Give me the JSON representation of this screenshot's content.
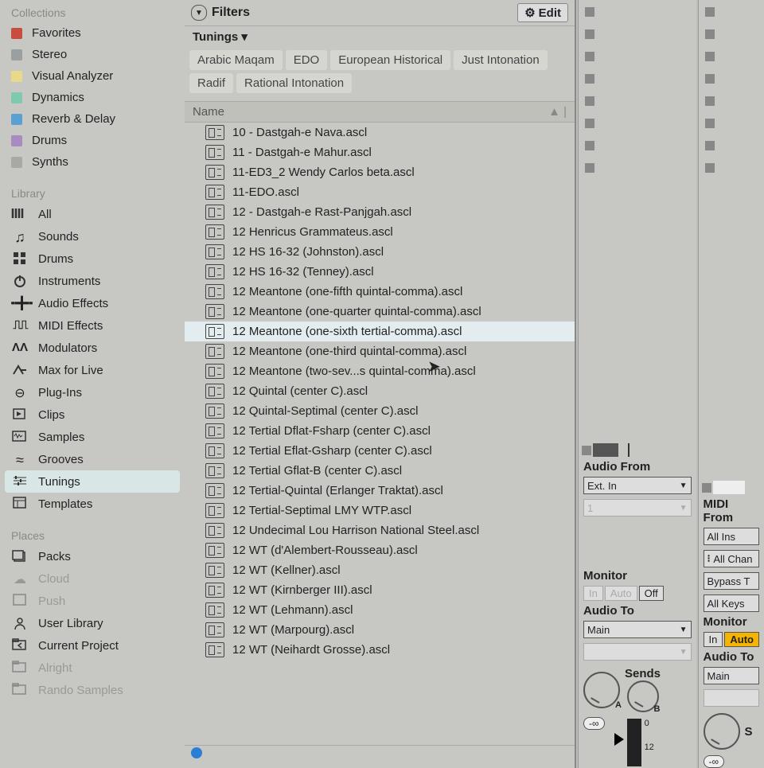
{
  "sidebar": {
    "collections_hd": "Collections",
    "collections": [
      {
        "label": "Favorites",
        "color": "#c84d3e"
      },
      {
        "label": "Stereo",
        "color": "#9aa0a0"
      },
      {
        "label": "Visual Analyzer",
        "color": "#e9d98b"
      },
      {
        "label": "Dynamics",
        "color": "#7fc9b0"
      },
      {
        "label": "Reverb & Delay",
        "color": "#5aa0d0"
      },
      {
        "label": "Drums",
        "color": "#a88bc0"
      },
      {
        "label": "Synths",
        "color": "#a8a8a4"
      }
    ],
    "library_hd": "Library",
    "library": [
      {
        "label": "All",
        "icon": "bars"
      },
      {
        "label": "Sounds",
        "icon": "note"
      },
      {
        "label": "Drums",
        "icon": "pads"
      },
      {
        "label": "Instruments",
        "icon": "power"
      },
      {
        "label": "Audio Effects",
        "icon": "wave"
      },
      {
        "label": "MIDI Effects",
        "icon": "midi"
      },
      {
        "label": "Modulators",
        "icon": "mod"
      },
      {
        "label": "Max for Live",
        "icon": "max"
      },
      {
        "label": "Plug-Ins",
        "icon": "plug"
      },
      {
        "label": "Clips",
        "icon": "clip"
      },
      {
        "label": "Samples",
        "icon": "samp"
      },
      {
        "label": "Grooves",
        "icon": "groove"
      },
      {
        "label": "Tunings",
        "icon": "tune",
        "selected": true
      },
      {
        "label": "Templates",
        "icon": "tmpl"
      }
    ],
    "places_hd": "Places",
    "places": [
      {
        "label": "Packs",
        "icon": "packs"
      },
      {
        "label": "Cloud",
        "icon": "cloud",
        "dim": true
      },
      {
        "label": "Push",
        "icon": "push",
        "dim": true
      },
      {
        "label": "User Library",
        "icon": "user"
      },
      {
        "label": "Current Project",
        "icon": "proj"
      },
      {
        "label": "Alright",
        "icon": "folder",
        "dim": true
      },
      {
        "label": "Rando Samples",
        "icon": "folder",
        "dim": true
      }
    ]
  },
  "browser": {
    "filters_label": "Filters",
    "edit_label": "Edit",
    "subheader": "Tunings ▾",
    "tags": [
      "Arabic Maqam",
      "EDO",
      "European Historical",
      "Just Intonation",
      "Radif",
      "Rational Intonation"
    ],
    "name_col": "Name",
    "items": [
      "10 - Dastgah-e Nava.ascl",
      "11 - Dastgah-e Mahur.ascl",
      "11-ED3_2 Wendy Carlos beta.ascl",
      "11-EDO.ascl",
      "12 - Dastgah-e Rast-Panjgah.ascl",
      "12 Henricus Grammateus.ascl",
      "12 HS 16-32 (Johnston).ascl",
      "12 HS 16-32 (Tenney).ascl",
      "12 Meantone (one-fifth quintal-comma).ascl",
      "12 Meantone (one-quarter quintal-comma).ascl",
      "12 Meantone (one-sixth tertial-comma).ascl",
      "12 Meantone (one-third quintal-comma).ascl",
      "12 Meantone (two-sev...s quintal-comma).ascl",
      "12 Quintal (center C).ascl",
      "12 Quintal-Septimal (center C).ascl",
      "12 Tertial Dflat-Fsharp (center C).ascl",
      "12 Tertial Eflat-Gsharp (center C).ascl",
      "12 Tertial Gflat-B (center C).ascl",
      "12 Tertial-Quintal (Erlanger Traktat).ascl",
      "12 Tertial-Septimal LMY WTP.ascl",
      "12 Undecimal Lou Harrison National Steel.ascl",
      "12 WT (d'Alembert-Rousseau).ascl",
      "12 WT (Kellner).ascl",
      "12 WT (Kirnberger III).ascl",
      "12 WT (Lehmann).ascl",
      "12 WT (Marpourg).ascl",
      "12 WT (Neihardt Grosse).ascl"
    ],
    "selected_index": 10
  },
  "mixer": {
    "track1": {
      "audio_from": "Audio From",
      "src": "Ext. In",
      "ch": "1",
      "monitor": "Monitor",
      "m_in": "In",
      "m_auto": "Auto",
      "m_off": "Off",
      "audio_to": "Audio To",
      "dest": "Main",
      "sends": "Sends",
      "inf": "-∞",
      "tick0": "0",
      "tick12": "12"
    },
    "track2": {
      "midi_from": "MIDI From",
      "src": "All Ins",
      "ch": "All Chan",
      "bypass": "Bypass T",
      "keys": "All Keys",
      "monitor": "Monitor",
      "m_in": "In",
      "m_auto": "Auto",
      "audio_to": "Audio To",
      "dest": "Main",
      "sends": "S",
      "inf": "-∞"
    }
  }
}
